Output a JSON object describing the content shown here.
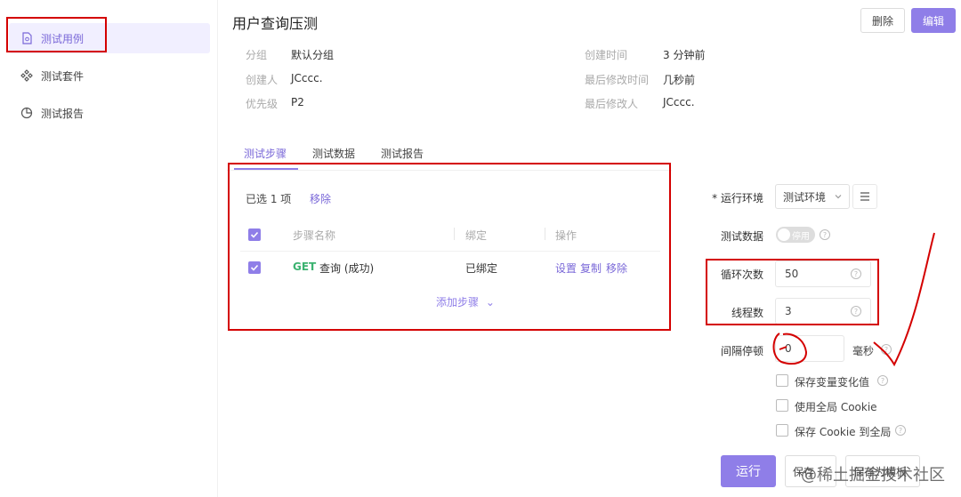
{
  "sidebar": {
    "items": [
      {
        "label": "测试用例",
        "icon": "file-icon",
        "active": true
      },
      {
        "label": "测试套件",
        "icon": "grid-icon",
        "active": false
      },
      {
        "label": "测试报告",
        "icon": "pie-chart-icon",
        "active": false
      }
    ]
  },
  "header": {
    "title": "用户查询压测",
    "delete_label": "删除",
    "edit_label": "编辑"
  },
  "meta": {
    "group_label": "分组",
    "group_value": "默认分组",
    "creator_label": "创建人",
    "creator_value": "JCccc.",
    "priority_label": "优先级",
    "priority_value": "P2",
    "created_label": "创建时间",
    "created_value": "3 分钟前",
    "modified_label": "最后修改时间",
    "modified_value": "几秒前",
    "modifier_label": "最后修改人",
    "modifier_value": "JCccc."
  },
  "tabs": [
    {
      "label": "测试步骤",
      "active": true
    },
    {
      "label": "测试数据",
      "active": false
    },
    {
      "label": "测试报告",
      "active": false
    }
  ],
  "steps": {
    "selected_text": "已选 1 项",
    "remove_label": "移除",
    "columns": [
      "步骤名称",
      "绑定",
      "操作"
    ],
    "rows": [
      {
        "method": "GET",
        "name": "查询 (成功)",
        "bound": "已绑定",
        "actions": [
          "设置",
          "复制",
          "移除"
        ]
      }
    ],
    "add_step_label": "添加步骤"
  },
  "run_form": {
    "env_label": "* 运行环境",
    "env_value": "测试环境",
    "data_label": "测试数据",
    "data_toggle_text": "停用",
    "loop_label": "循环次数",
    "loop_value": "50",
    "threads_label": "线程数",
    "threads_value": "3",
    "interval_label": "间隔停顿",
    "interval_value": "0",
    "interval_unit": "毫秒",
    "options": [
      "保存变量变化值",
      "使用全局 Cookie",
      "保存 Cookie 到全局"
    ],
    "run_label": "运行",
    "save_label": "保存",
    "save_more_label": "保存为模板"
  },
  "watermark": "@稀土掘金技术社区",
  "colors": {
    "accent": "#8f7ee8",
    "annotation": "#d40000",
    "method_get": "#3cb371"
  }
}
